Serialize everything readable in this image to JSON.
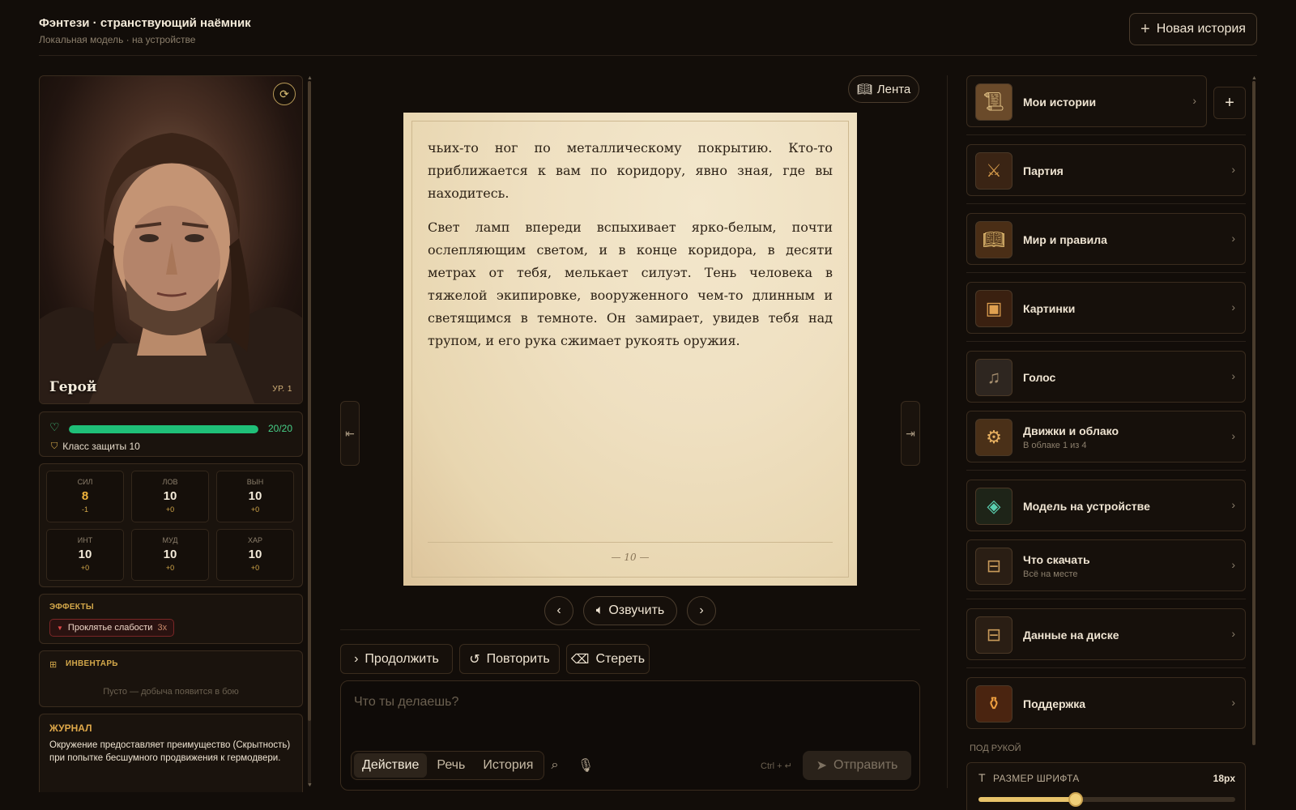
{
  "header": {
    "title": "Фэнтези · странствующий наёмник",
    "subtitle": "Локальная модель · на устройстве",
    "new_story": "Новая история"
  },
  "hero": {
    "name": "Герой",
    "level": "УР. 1",
    "hp_text": "20/20",
    "hp_fraction": 1.0,
    "ac_text": "Класс защиты 10",
    "stats": [
      {
        "name": "СИЛ",
        "value": "8",
        "mod": "-1"
      },
      {
        "name": "ЛОВ",
        "value": "10",
        "mod": "+0"
      },
      {
        "name": "ВЫН",
        "value": "10",
        "mod": "+0"
      },
      {
        "name": "ИНТ",
        "value": "10",
        "mod": "+0"
      },
      {
        "name": "МУД",
        "value": "10",
        "mod": "+0"
      },
      {
        "name": "ХАР",
        "value": "10",
        "mod": "+0"
      }
    ]
  },
  "effects": {
    "label": "ЭФФЕКТЫ",
    "items": [
      {
        "name": "Проклятье слабости",
        "stack": "3x"
      }
    ]
  },
  "inventory": {
    "label": "ИНВЕНТАРЬ",
    "empty": "Пусто — добыча появится в бою"
  },
  "journal": {
    "label": "ЖУРНАЛ",
    "text": "Окружение предоставляет преимущество (Скрытность) при попытке бесшумного продвижения к гермодвери."
  },
  "reader": {
    "feed_label": "Лента",
    "paragraphs": [
      "чьих-то ног по металлическому покрытию. Кто-то приближается к вам по коридору, явно зная, где вы находитесь.",
      "Свет ламп впереди вспыхивает ярко-белым, почти ослепляющим светом, и в конце коридора, в десяти метрах от тебя, мелькает силуэт. Тень человека в тяжелой экипировке, вооруженного чем-то длинным и светящимся в темноте. Он замирает, увидев тебя над трупом, и его рука сжимает рукоять оружия."
    ],
    "page_number": "— 10 —",
    "voice_label": "Озвучить"
  },
  "actions": {
    "continue": "Продолжить",
    "retry": "Повторить",
    "erase": "Стереть"
  },
  "composer": {
    "placeholder": "Что ты делаешь?",
    "modes": [
      "Действие",
      "Речь",
      "История"
    ],
    "active_mode": "Действие",
    "hint": "Ctrl + ↵",
    "send": "Отправить"
  },
  "menu": {
    "items": [
      {
        "label": "Мои истории",
        "sub": "",
        "icon": "scroll-icon"
      },
      {
        "label": "Партия",
        "sub": "",
        "icon": "party-icon"
      },
      {
        "label": "Мир и правила",
        "sub": "",
        "icon": "book-icon"
      },
      {
        "label": "Картинки",
        "sub": "",
        "icon": "picture-icon"
      },
      {
        "label": "Голос",
        "sub": "",
        "icon": "voice-icon"
      },
      {
        "label": "Движки и облако",
        "sub": "В облаке 1 из 4",
        "icon": "engine-icon"
      },
      {
        "label": "Модель на устройстве",
        "sub": "",
        "icon": "device-model-icon"
      },
      {
        "label": "Что скачать",
        "sub": "Всё на месте",
        "icon": "download-chest-icon"
      },
      {
        "label": "Данные на диске",
        "sub": "",
        "icon": "disk-chest-icon"
      },
      {
        "label": "Поддержка",
        "sub": "",
        "icon": "support-potion-icon"
      }
    ]
  },
  "settings": {
    "section": "ПОД РУКОЙ",
    "font_size_label": "РАЗМЕР ШРИФТА",
    "font_size_value": "18px",
    "font_size_fraction": 0.38
  },
  "colors": {
    "accent": "#d4a84a",
    "hp": "#1fbf78",
    "background": "#120d09",
    "paper": "#efe0c1",
    "effect_red": "#e04848"
  }
}
